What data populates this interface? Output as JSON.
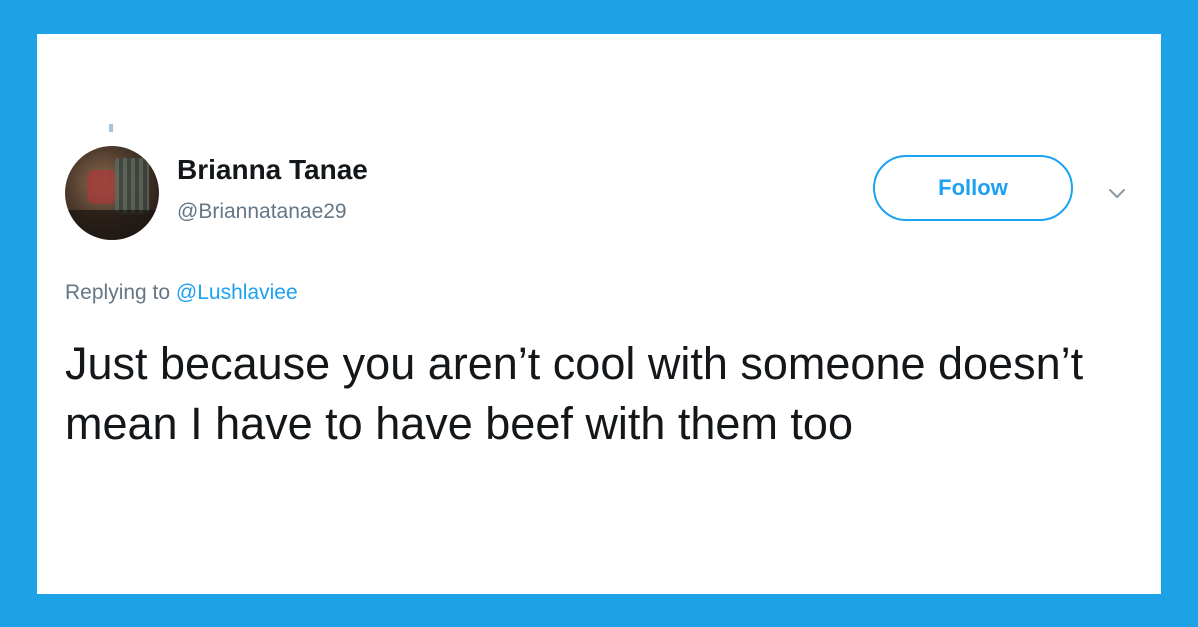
{
  "colors": {
    "frame": "#1da1e7",
    "card": "#ffffff",
    "accent": "#1da1f2",
    "text_primary": "#14171a",
    "text_secondary": "#657786"
  },
  "tweet": {
    "author_name": "Brianna Tanae",
    "author_handle": "@Briannatanae29",
    "follow_label": "Follow",
    "menu_icon": "chevron-down-icon",
    "replying_prefix": "Replying to",
    "replying_to": "@Lushlaviee",
    "text": "Just because you aren’t cool with someone doesn’t mean I have to have beef with them too"
  }
}
